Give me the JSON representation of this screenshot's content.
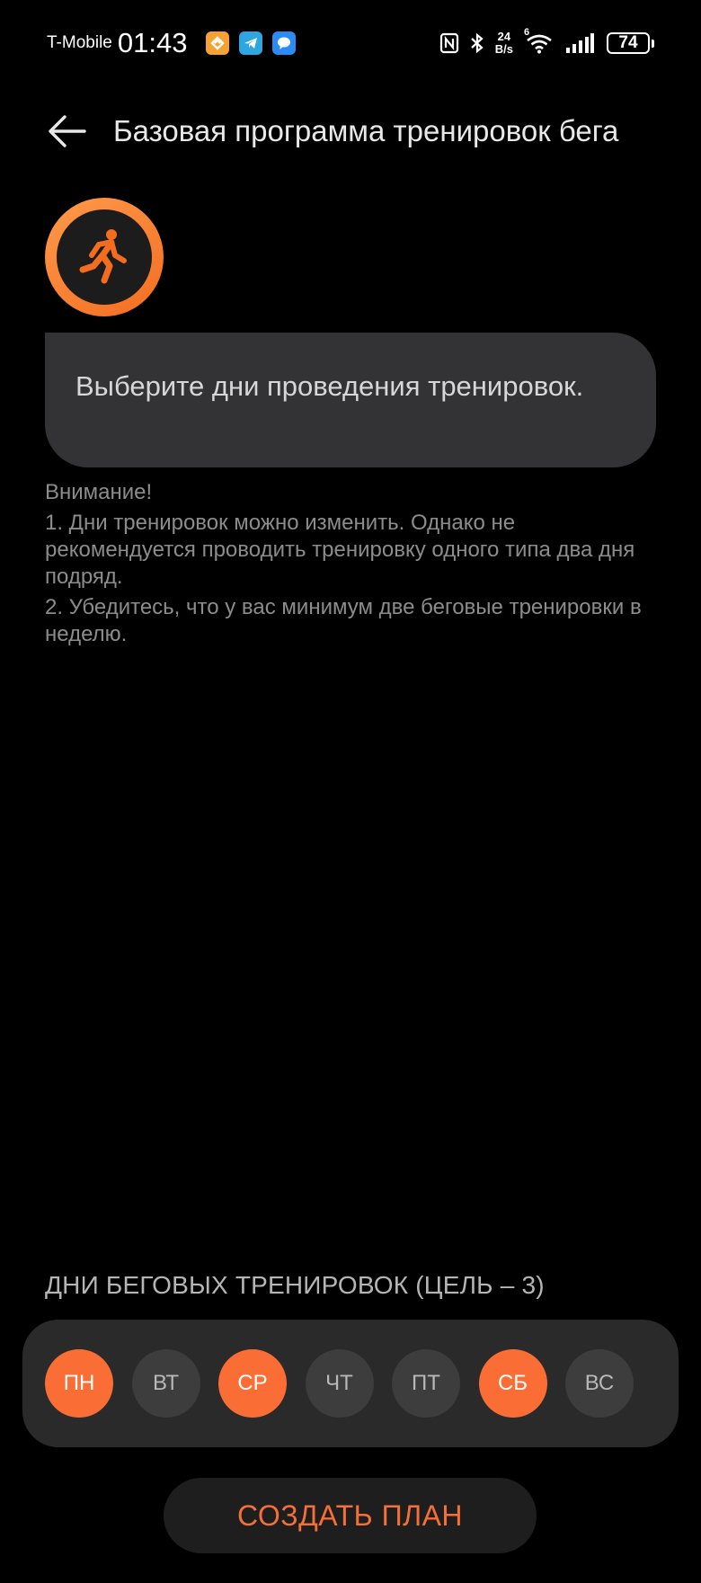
{
  "status_bar": {
    "carrier": "T-Mobile",
    "time": "01:43",
    "apps": [
      "orange-app-icon",
      "telegram-icon",
      "messages-icon"
    ],
    "net_speed_value": "24",
    "net_speed_unit": "B/s",
    "wifi_label": "6",
    "battery": "74"
  },
  "header": {
    "title": "Базовая программа тренировок бега",
    "back_icon": "arrow-left-icon"
  },
  "avatar": {
    "icon": "runner-icon",
    "accent": "#f36d21"
  },
  "prompt": {
    "text": "Выберите дни проведения тренировок."
  },
  "notes": {
    "heading": "Внимание!",
    "items": [
      "1. Дни тренировок можно изменить. Однако не рекомендуется проводить тренировку одного типа два дня подряд.",
      "2. Убедитесь, что у вас минимум две беговые тренировки в неделю."
    ]
  },
  "days": {
    "title": "ДНИ БЕГОВЫХ ТРЕНИРОВОК (ЦЕЛЬ – 3)",
    "items": [
      {
        "label": "ПН",
        "selected": true
      },
      {
        "label": "ВТ",
        "selected": false
      },
      {
        "label": "СР",
        "selected": true
      },
      {
        "label": "ЧТ",
        "selected": false
      },
      {
        "label": "ПТ",
        "selected": false
      },
      {
        "label": "СБ",
        "selected": true
      },
      {
        "label": "ВС",
        "selected": false
      }
    ]
  },
  "action": {
    "create_label": "СОЗДАТЬ ПЛАН"
  },
  "colors": {
    "accent": "#fa6e36",
    "background": "#000000",
    "panel": "#2a2a2a"
  }
}
